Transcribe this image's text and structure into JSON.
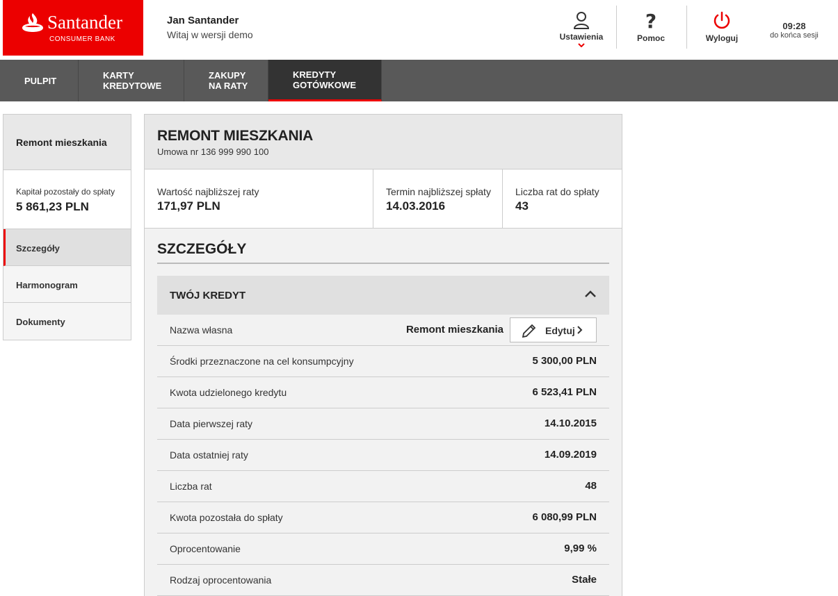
{
  "header": {
    "brand": "Santander",
    "brand_sub": "CONSUMER BANK",
    "user_name": "Jan Santander",
    "user_sub": "Witaj w wersji demo",
    "settings_label": "Ustawienia",
    "help_label": "Pomoc",
    "logout_label": "Wyloguj",
    "session_time": "09:28",
    "session_label": "do końca sesji"
  },
  "nav": [
    {
      "label": "PULPIT"
    },
    {
      "label": "KARTY KREDYTOWE"
    },
    {
      "label": "ZAKUPY NA RATY"
    },
    {
      "label": "KREDYTY GOTÓWKOWE"
    }
  ],
  "sidebar": {
    "title": "Remont mieszkania",
    "capital_label": "Kapitał pozostały do spłaty",
    "capital_value": "5 861,23 PLN",
    "items": [
      {
        "label": "Szczegóły"
      },
      {
        "label": "Harmonogram"
      },
      {
        "label": "Dokumenty"
      }
    ]
  },
  "main": {
    "title": "REMONT MIESZKANIA",
    "contract": "Umowa nr 136 999 990 100",
    "stats": [
      {
        "label": "Wartość najbliższej raty",
        "value": "171,97 PLN"
      },
      {
        "label": "Termin najbliższej spłaty",
        "value": "14.03.2016"
      },
      {
        "label": "Liczba rat do spłaty",
        "value": "43"
      }
    ],
    "section_title": "SZCZEGÓŁY",
    "credit_title": "TWÓJ KREDYT",
    "edit_label": "Edytuj",
    "rows": [
      {
        "key": "Nazwa własna",
        "value": "Remont mieszkania"
      },
      {
        "key": "Środki przeznaczone na cel konsumpcyjny",
        "value": "5 300,00 PLN"
      },
      {
        "key": "Kwota udzielonego kredytu",
        "value": "6 523,41 PLN"
      },
      {
        "key": "Data pierwszej raty",
        "value": "14.10.2015"
      },
      {
        "key": "Data ostatniej raty",
        "value": "14.09.2019"
      },
      {
        "key": "Liczba rat",
        "value": "48"
      },
      {
        "key": "Kwota pozostała do spłaty",
        "value": "6 080,99 PLN"
      },
      {
        "key": "Oprocentowanie",
        "value": "9,99 %"
      },
      {
        "key": "Rodzaj oprocentowania",
        "value": "Stałe"
      }
    ]
  },
  "colors": {
    "brand_red": "#ec0000",
    "nav_bg": "#595959",
    "nav_active": "#333333"
  }
}
